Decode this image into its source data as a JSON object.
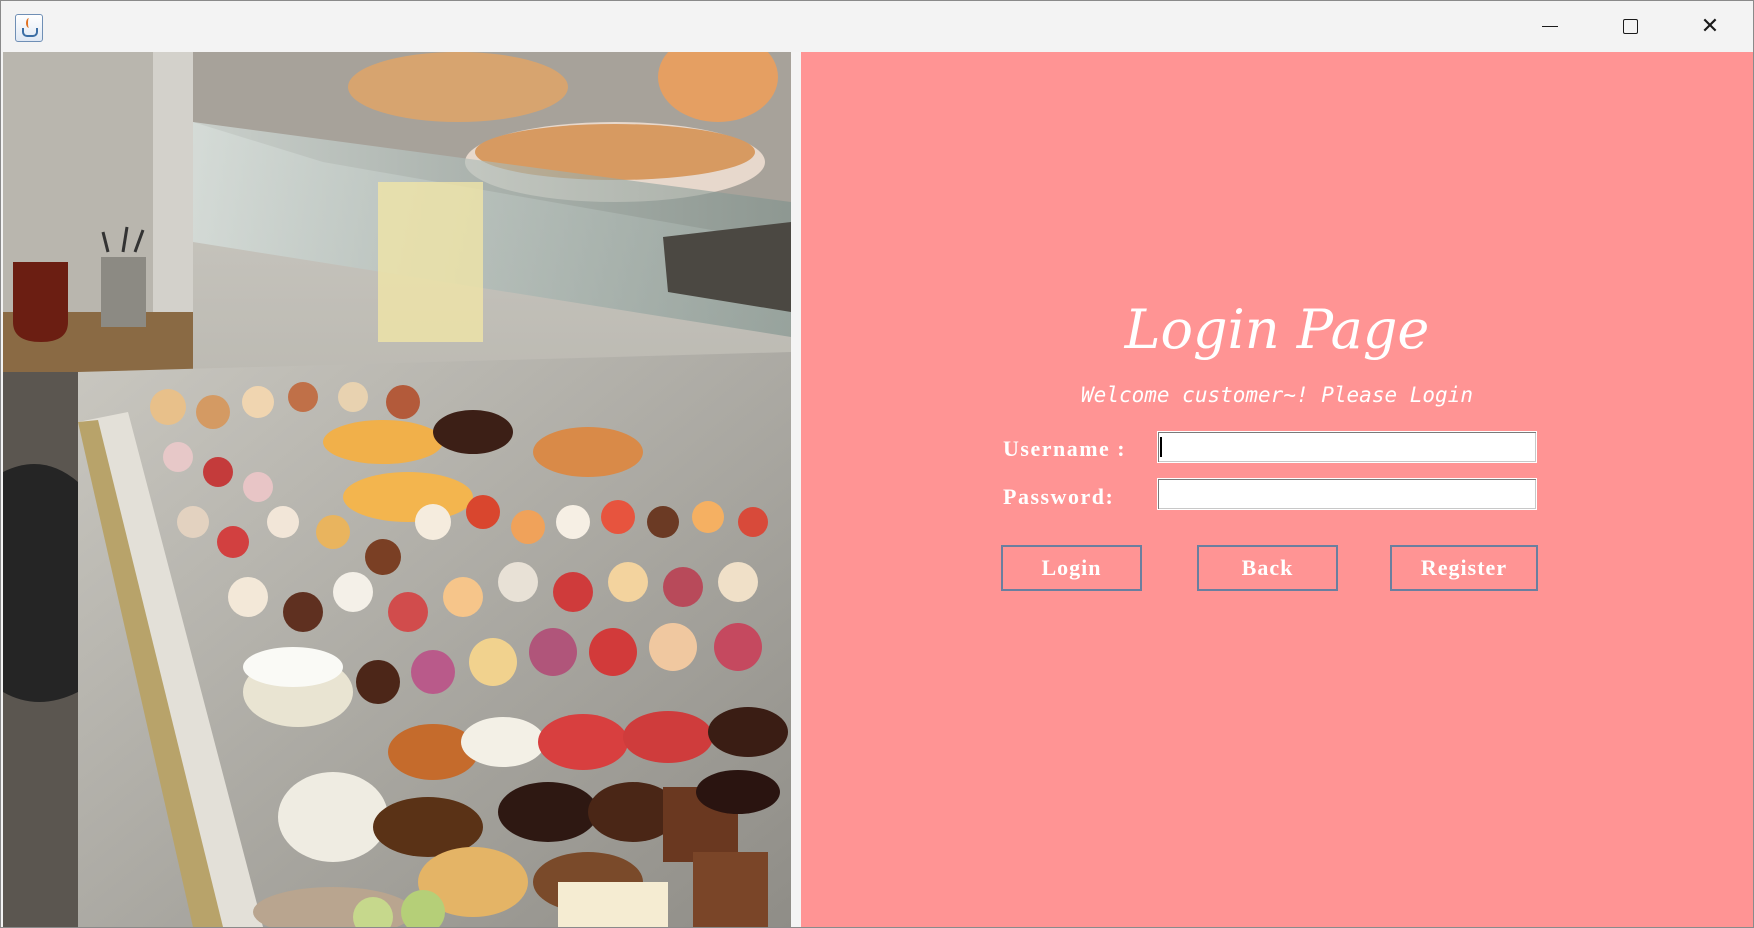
{
  "window": {
    "app_icon": "java-cup-icon",
    "controls": [
      "minimize-icon",
      "maximize-icon",
      "close-icon"
    ]
  },
  "photo": {
    "icon": "pastry-display-photo"
  },
  "login": {
    "title": "Login Page",
    "subtitle": "Welcome customer~! Please Login",
    "username_label": "Username :",
    "password_label": "Password:",
    "username_value": "",
    "password_value": "",
    "login_button": "Login",
    "back_button": "Back",
    "register_button": "Register"
  },
  "colors": {
    "panel_background": "#ff9494",
    "text": "#ffffff",
    "button_border": "#6a7f9f"
  }
}
